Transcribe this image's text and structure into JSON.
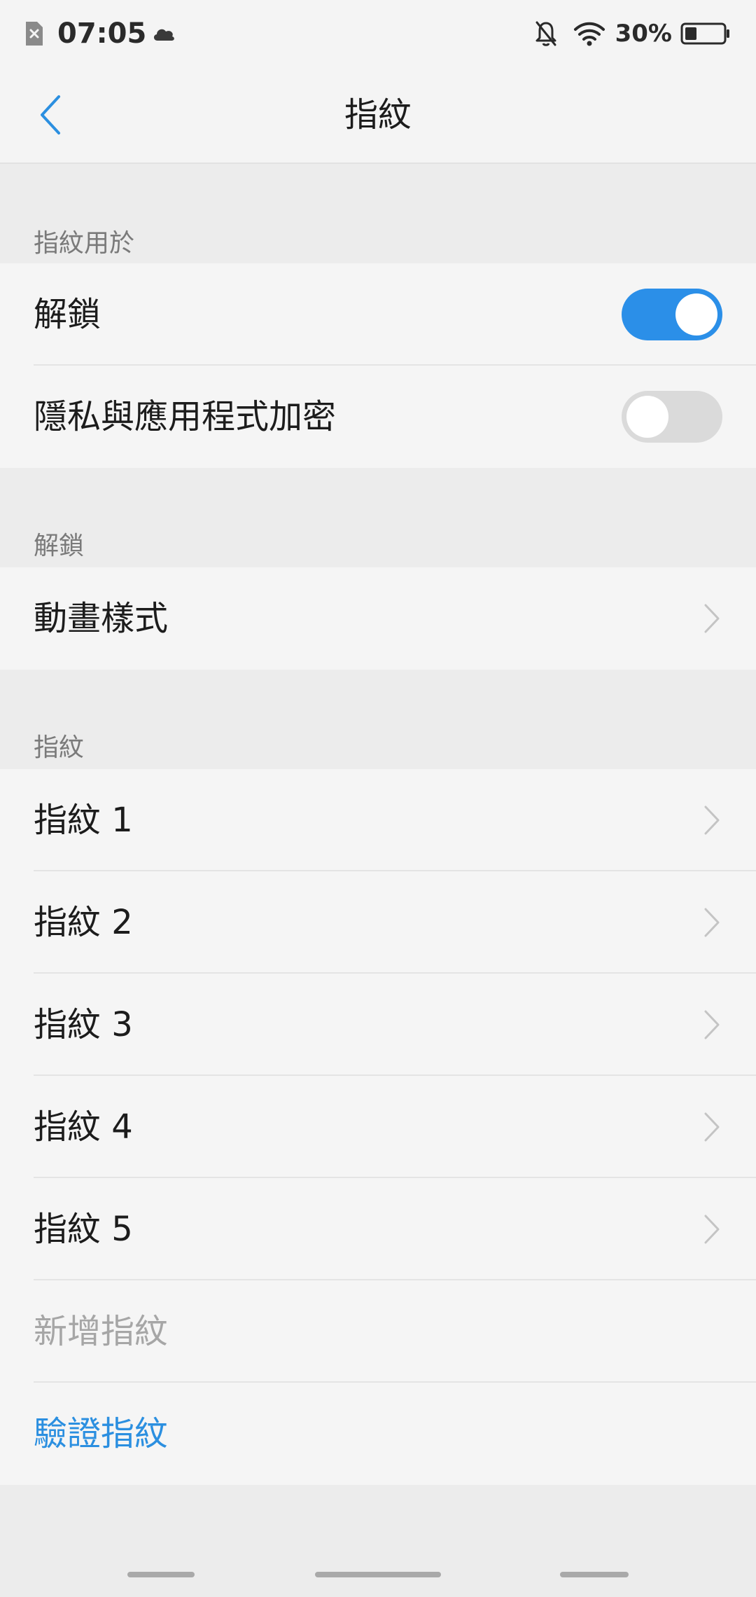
{
  "status_bar": {
    "time": "07:05",
    "battery_percent": "30%",
    "battery_level": 0.3,
    "icons": [
      "sim-card-icon",
      "cloud-icon",
      "bell-off-icon",
      "wifi-icon",
      "battery-icon"
    ]
  },
  "header": {
    "title": "指紋",
    "back_icon": "chevron-left-icon"
  },
  "sections": {
    "usage": {
      "header": "指紋用於",
      "items": [
        {
          "label": "解鎖",
          "toggle": true
        },
        {
          "label": "隱私與應用程式加密",
          "toggle": false
        }
      ]
    },
    "unlock": {
      "header": "解鎖",
      "items": [
        {
          "label": "動畫樣式"
        }
      ]
    },
    "fingerprints": {
      "header": "指紋",
      "items": [
        {
          "label": "指紋 1"
        },
        {
          "label": "指紋 2"
        },
        {
          "label": "指紋 3"
        },
        {
          "label": "指紋 4"
        },
        {
          "label": "指紋 5"
        }
      ],
      "add_label": "新增指紋",
      "verify_label": "驗證指紋"
    }
  },
  "colors": {
    "accent": "#2b8fe8",
    "link": "#2b8fe0",
    "toggle_off": "#dadada",
    "disabled_text": "#a6a6a6",
    "background": "#ececec",
    "surface": "#f5f5f5"
  }
}
